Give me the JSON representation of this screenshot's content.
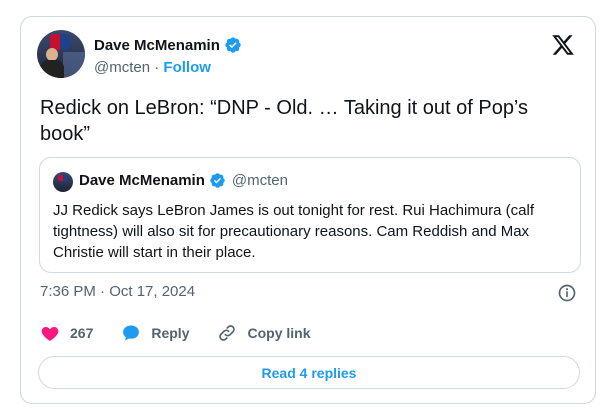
{
  "author": {
    "name": "Dave McMenamin",
    "handle": "@mcten",
    "separator": "·",
    "follow_label": "Follow"
  },
  "tweet": {
    "text": "Redick on LeBron: “DNP - Old. … Taking it out of Pop’s book”",
    "timestamp": "7:36 PM · Oct 17, 2024"
  },
  "quoted_tweet": {
    "name": "Dave McMenamin",
    "handle": "@mcten",
    "text": "JJ Redick says LeBron James is out tonight for rest. Rui Hachimura (calf tightness) will also sit for precautionary reasons. Cam Reddish and Max Christie will start in their place."
  },
  "actions": {
    "like_count": "267",
    "reply_label": "Reply",
    "copy_link_label": "Copy link"
  },
  "read_replies_label": "Read 4 replies",
  "colors": {
    "accent": "#1d9bf0",
    "like": "#f91880",
    "muted": "#536471",
    "border": "#cfd9de"
  },
  "icons": {
    "brand": "x-logo-icon",
    "verified": "verified-badge-icon",
    "info": "info-icon",
    "like": "heart-icon",
    "reply": "speech-bubble-icon",
    "copy_link": "link-icon"
  }
}
